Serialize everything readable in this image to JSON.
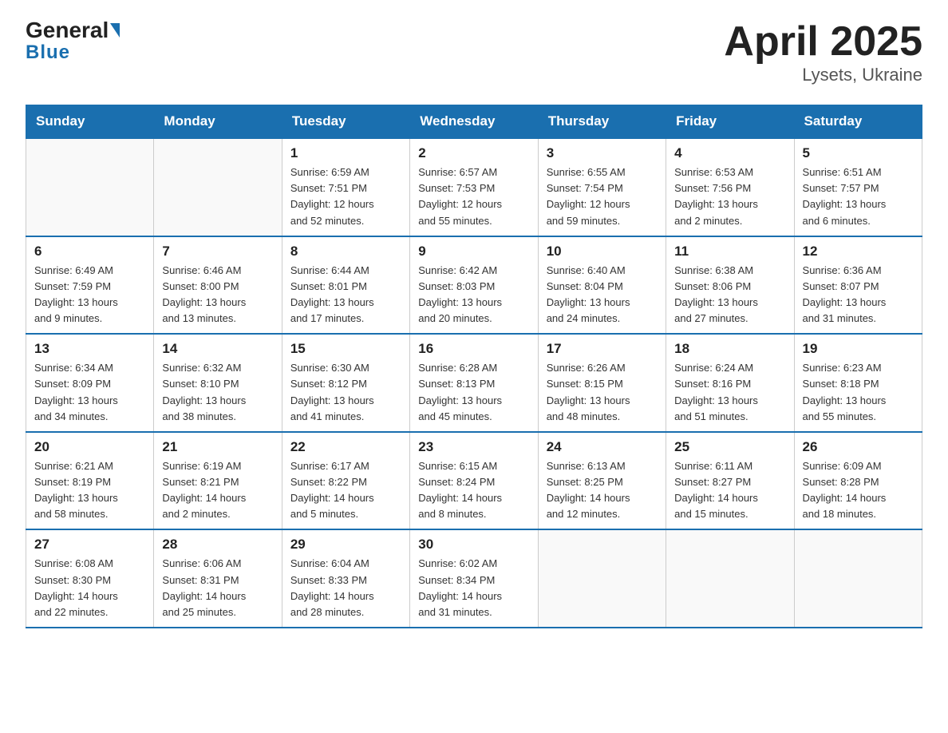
{
  "header": {
    "logo_general": "General",
    "logo_blue": "Blue",
    "month_year": "April 2025",
    "location": "Lysets, Ukraine"
  },
  "weekdays": [
    "Sunday",
    "Monday",
    "Tuesday",
    "Wednesday",
    "Thursday",
    "Friday",
    "Saturday"
  ],
  "weeks": [
    [
      {
        "day": "",
        "info": ""
      },
      {
        "day": "",
        "info": ""
      },
      {
        "day": "1",
        "info": "Sunrise: 6:59 AM\nSunset: 7:51 PM\nDaylight: 12 hours\nand 52 minutes."
      },
      {
        "day": "2",
        "info": "Sunrise: 6:57 AM\nSunset: 7:53 PM\nDaylight: 12 hours\nand 55 minutes."
      },
      {
        "day": "3",
        "info": "Sunrise: 6:55 AM\nSunset: 7:54 PM\nDaylight: 12 hours\nand 59 minutes."
      },
      {
        "day": "4",
        "info": "Sunrise: 6:53 AM\nSunset: 7:56 PM\nDaylight: 13 hours\nand 2 minutes."
      },
      {
        "day": "5",
        "info": "Sunrise: 6:51 AM\nSunset: 7:57 PM\nDaylight: 13 hours\nand 6 minutes."
      }
    ],
    [
      {
        "day": "6",
        "info": "Sunrise: 6:49 AM\nSunset: 7:59 PM\nDaylight: 13 hours\nand 9 minutes."
      },
      {
        "day": "7",
        "info": "Sunrise: 6:46 AM\nSunset: 8:00 PM\nDaylight: 13 hours\nand 13 minutes."
      },
      {
        "day": "8",
        "info": "Sunrise: 6:44 AM\nSunset: 8:01 PM\nDaylight: 13 hours\nand 17 minutes."
      },
      {
        "day": "9",
        "info": "Sunrise: 6:42 AM\nSunset: 8:03 PM\nDaylight: 13 hours\nand 20 minutes."
      },
      {
        "day": "10",
        "info": "Sunrise: 6:40 AM\nSunset: 8:04 PM\nDaylight: 13 hours\nand 24 minutes."
      },
      {
        "day": "11",
        "info": "Sunrise: 6:38 AM\nSunset: 8:06 PM\nDaylight: 13 hours\nand 27 minutes."
      },
      {
        "day": "12",
        "info": "Sunrise: 6:36 AM\nSunset: 8:07 PM\nDaylight: 13 hours\nand 31 minutes."
      }
    ],
    [
      {
        "day": "13",
        "info": "Sunrise: 6:34 AM\nSunset: 8:09 PM\nDaylight: 13 hours\nand 34 minutes."
      },
      {
        "day": "14",
        "info": "Sunrise: 6:32 AM\nSunset: 8:10 PM\nDaylight: 13 hours\nand 38 minutes."
      },
      {
        "day": "15",
        "info": "Sunrise: 6:30 AM\nSunset: 8:12 PM\nDaylight: 13 hours\nand 41 minutes."
      },
      {
        "day": "16",
        "info": "Sunrise: 6:28 AM\nSunset: 8:13 PM\nDaylight: 13 hours\nand 45 minutes."
      },
      {
        "day": "17",
        "info": "Sunrise: 6:26 AM\nSunset: 8:15 PM\nDaylight: 13 hours\nand 48 minutes."
      },
      {
        "day": "18",
        "info": "Sunrise: 6:24 AM\nSunset: 8:16 PM\nDaylight: 13 hours\nand 51 minutes."
      },
      {
        "day": "19",
        "info": "Sunrise: 6:23 AM\nSunset: 8:18 PM\nDaylight: 13 hours\nand 55 minutes."
      }
    ],
    [
      {
        "day": "20",
        "info": "Sunrise: 6:21 AM\nSunset: 8:19 PM\nDaylight: 13 hours\nand 58 minutes."
      },
      {
        "day": "21",
        "info": "Sunrise: 6:19 AM\nSunset: 8:21 PM\nDaylight: 14 hours\nand 2 minutes."
      },
      {
        "day": "22",
        "info": "Sunrise: 6:17 AM\nSunset: 8:22 PM\nDaylight: 14 hours\nand 5 minutes."
      },
      {
        "day": "23",
        "info": "Sunrise: 6:15 AM\nSunset: 8:24 PM\nDaylight: 14 hours\nand 8 minutes."
      },
      {
        "day": "24",
        "info": "Sunrise: 6:13 AM\nSunset: 8:25 PM\nDaylight: 14 hours\nand 12 minutes."
      },
      {
        "day": "25",
        "info": "Sunrise: 6:11 AM\nSunset: 8:27 PM\nDaylight: 14 hours\nand 15 minutes."
      },
      {
        "day": "26",
        "info": "Sunrise: 6:09 AM\nSunset: 8:28 PM\nDaylight: 14 hours\nand 18 minutes."
      }
    ],
    [
      {
        "day": "27",
        "info": "Sunrise: 6:08 AM\nSunset: 8:30 PM\nDaylight: 14 hours\nand 22 minutes."
      },
      {
        "day": "28",
        "info": "Sunrise: 6:06 AM\nSunset: 8:31 PM\nDaylight: 14 hours\nand 25 minutes."
      },
      {
        "day": "29",
        "info": "Sunrise: 6:04 AM\nSunset: 8:33 PM\nDaylight: 14 hours\nand 28 minutes."
      },
      {
        "day": "30",
        "info": "Sunrise: 6:02 AM\nSunset: 8:34 PM\nDaylight: 14 hours\nand 31 minutes."
      },
      {
        "day": "",
        "info": ""
      },
      {
        "day": "",
        "info": ""
      },
      {
        "day": "",
        "info": ""
      }
    ]
  ]
}
